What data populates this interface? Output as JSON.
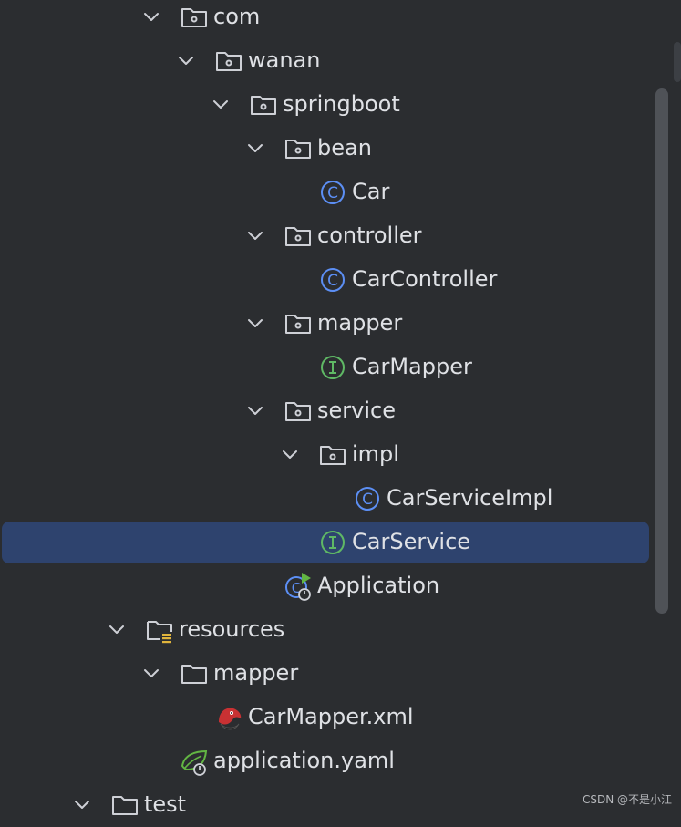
{
  "project_tree": {
    "items": [
      {
        "label": "com",
        "icon": "package-folder-icon",
        "expanded": true
      },
      {
        "label": "wanan",
        "icon": "package-folder-icon",
        "expanded": true
      },
      {
        "label": "springboot",
        "icon": "package-folder-icon",
        "expanded": true
      },
      {
        "label": "bean",
        "icon": "package-folder-icon",
        "expanded": true
      },
      {
        "label": "Car",
        "icon": "java-class-icon"
      },
      {
        "label": "controller",
        "icon": "package-folder-icon",
        "expanded": true
      },
      {
        "label": "CarController",
        "icon": "java-class-icon"
      },
      {
        "label": "mapper",
        "icon": "package-folder-icon",
        "expanded": true
      },
      {
        "label": "CarMapper",
        "icon": "java-interface-icon"
      },
      {
        "label": "service",
        "icon": "package-folder-icon",
        "expanded": true
      },
      {
        "label": "impl",
        "icon": "package-folder-icon",
        "expanded": true
      },
      {
        "label": "CarServiceImpl",
        "icon": "java-class-icon"
      },
      {
        "label": "CarService",
        "icon": "java-interface-icon",
        "selected": true
      },
      {
        "label": "Application",
        "icon": "spring-boot-application-icon"
      },
      {
        "label": "resources",
        "icon": "resources-folder-icon",
        "expanded": true
      },
      {
        "label": "mapper",
        "icon": "folder-icon",
        "expanded": true
      },
      {
        "label": "CarMapper.xml",
        "icon": "mybatis-xml-icon"
      },
      {
        "label": "application.yaml",
        "icon": "spring-yaml-icon"
      },
      {
        "label": "test",
        "icon": "folder-icon",
        "expanded": true
      }
    ]
  },
  "watermark": "CSDN @不是小江",
  "colors": {
    "background": "#2b2d30",
    "selection": "#2e436e",
    "text": "#dfe1e5",
    "class_icon": "#5c8ff5",
    "interface_icon": "#5fb865",
    "spring_green": "#62b543"
  }
}
